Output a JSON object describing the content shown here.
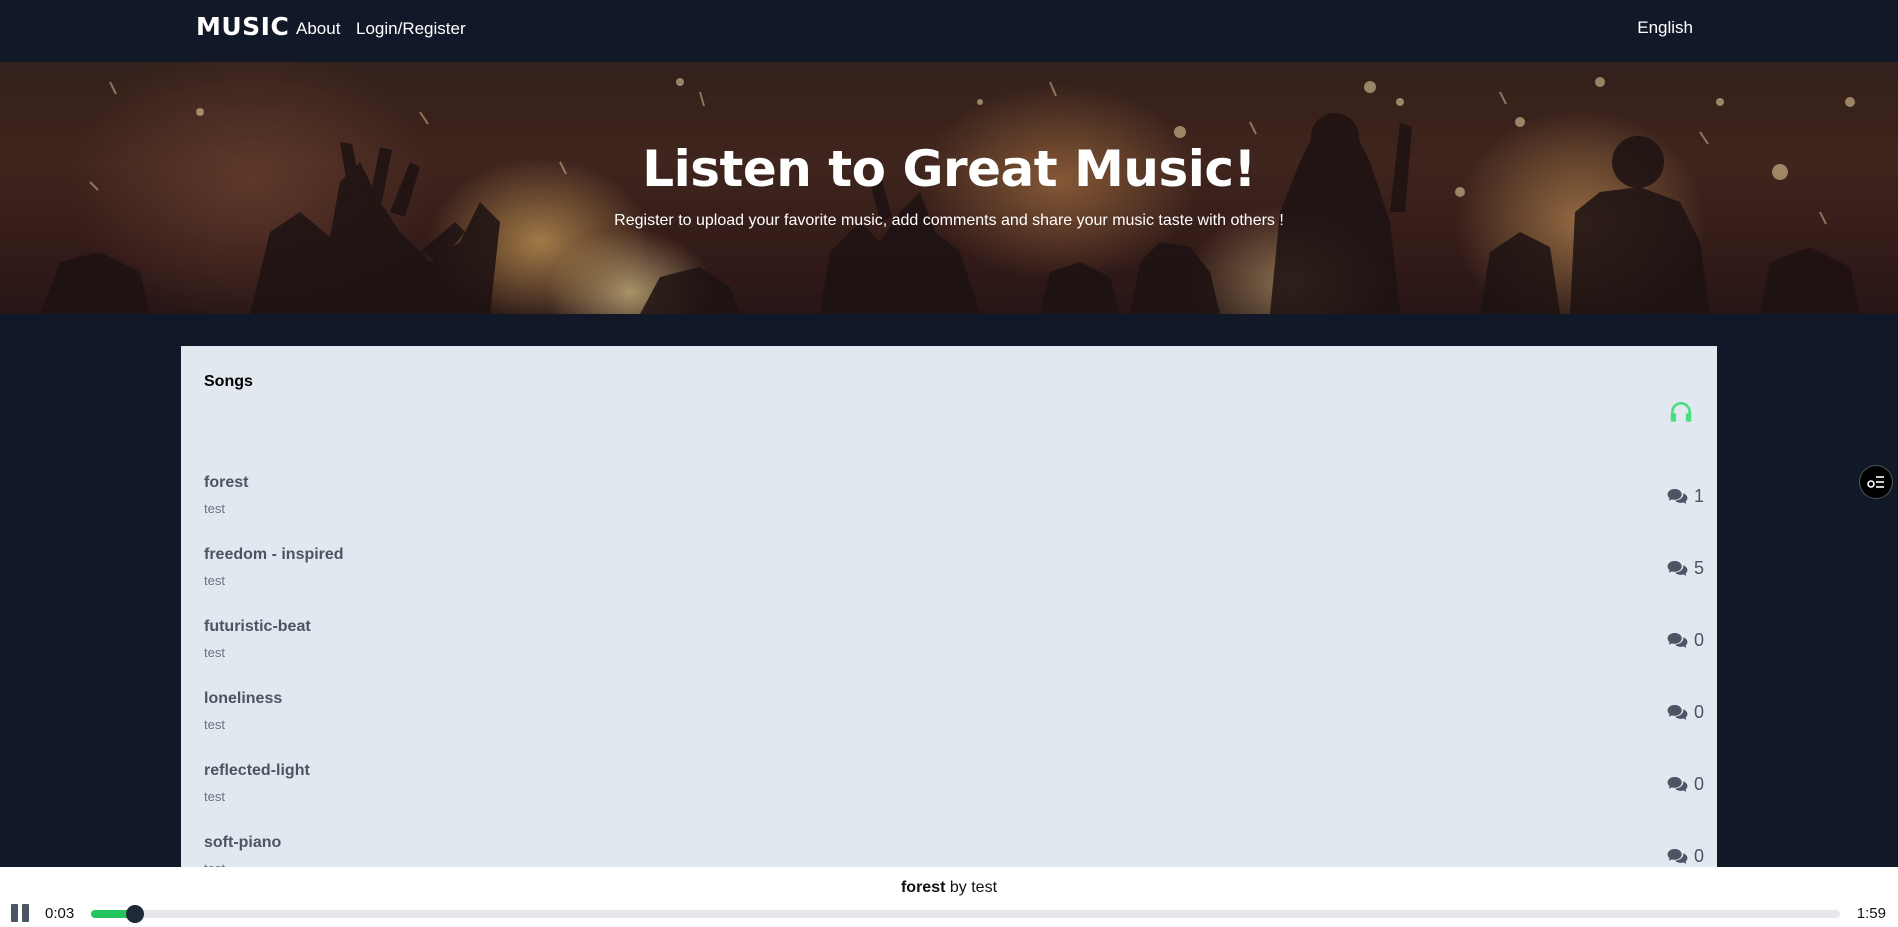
{
  "navbar": {
    "brand": "MUSIC",
    "about": "About",
    "login": "Login/Register",
    "language": "English"
  },
  "hero": {
    "title": "Listen to Great Music!",
    "subtitle": "Register to upload your favorite music, add comments and share your music taste with others !"
  },
  "songs_panel": {
    "title": "Songs",
    "header_icon": "headphones-icon",
    "comment_icon": "comments-icon",
    "songs": [
      {
        "title": "forest",
        "artist": "test",
        "comments": "1"
      },
      {
        "title": "freedom - inspired",
        "artist": "test",
        "comments": "5"
      },
      {
        "title": "futuristic-beat",
        "artist": "test",
        "comments": "0"
      },
      {
        "title": "loneliness",
        "artist": "test",
        "comments": "0"
      },
      {
        "title": "reflected-light",
        "artist": "test",
        "comments": "0"
      },
      {
        "title": "soft-piano",
        "artist": "test",
        "comments": "0"
      }
    ]
  },
  "player": {
    "song_title": "forest",
    "by_text": "by",
    "artist": "test",
    "current_time": "0:03",
    "total_time": "1:59",
    "progress_fraction": 0.025,
    "pause_icon": "pause-icon"
  },
  "side_button": {
    "icon": "playlist-icon"
  },
  "colors": {
    "background": "#111827",
    "panel": "#e2e8f0",
    "accent_green": "#22c55e",
    "headphones_green": "#4ade80"
  }
}
